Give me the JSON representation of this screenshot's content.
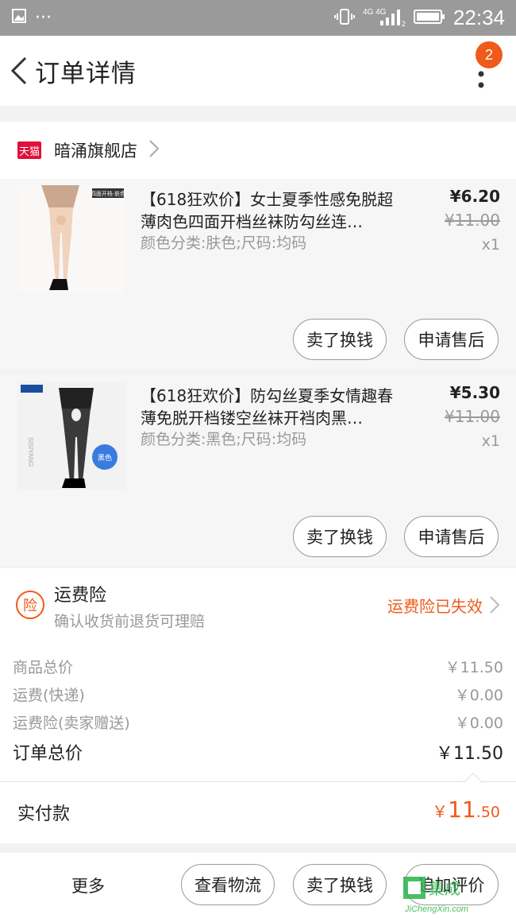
{
  "status_bar": {
    "time": "22:34",
    "network": "4G 4G",
    "sim": "2"
  },
  "nav": {
    "title": "订单详情",
    "badge_count": "2"
  },
  "store": {
    "platform_badge": "天猫",
    "name": "暗涌旗舰店"
  },
  "items": [
    {
      "title": "【618狂欢价】女士夏季性感免脱超薄肉色四面开档丝袜防勾丝连…",
      "sku": "颜色分类:肤色;尺码:均码",
      "price": "¥6.20",
      "original_price": "¥11.00",
      "qty": "x1",
      "thumb_label": "四面开档·肤色",
      "btn_resell": "卖了换钱",
      "btn_after_sale": "申请售后"
    },
    {
      "title": "【618狂欢价】防勾丝夏季女情趣春薄免脱开档镂空丝袜开裆肉黑…",
      "sku": "颜色分类:黑色;尺码:均码",
      "price": "¥5.30",
      "original_price": "¥11.00",
      "qty": "x1",
      "thumb_label": "黑色",
      "btn_resell": "卖了换钱",
      "btn_after_sale": "申请售后"
    }
  ],
  "insurance": {
    "icon_text": "险",
    "title": "运费险",
    "subtitle": "确认收货前退货可理赔",
    "status": "运费险已失效"
  },
  "summary": {
    "rows": [
      {
        "label": "商品总价",
        "value": "￥11.50"
      },
      {
        "label": "运费(快递)",
        "value": "￥0.00"
      },
      {
        "label": "运费险(卖家赠送)",
        "value": "￥0.00"
      }
    ],
    "total_label": "订单总价",
    "total_value": "￥11.50"
  },
  "paid": {
    "label": "实付款",
    "currency": "￥",
    "integer": "11",
    "decimal": ".50"
  },
  "bottom": {
    "more": "更多",
    "logistics": "查看物流",
    "resell": "卖了换钱",
    "review": "追加评价"
  },
  "watermark": {
    "line1": "集成",
    "line2": "JiChengXin.com"
  },
  "colors": {
    "accent": "#f05a1a",
    "tmall": "#e0103a",
    "statusbar": "#9a9a9a"
  }
}
